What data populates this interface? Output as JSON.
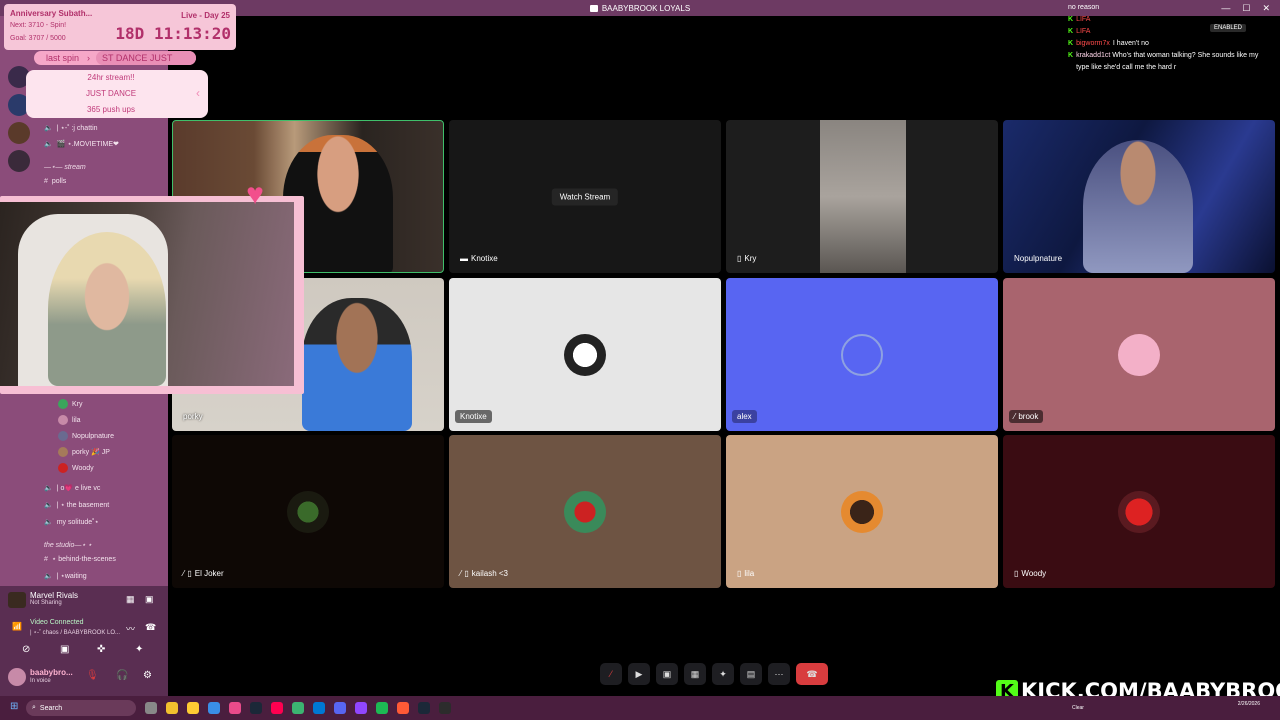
{
  "window": {
    "title": "BAABYBROOK LOYALS",
    "controls": [
      "—",
      "☐",
      "✕"
    ]
  },
  "overlay": {
    "title": "Anniversary Subath...",
    "next": "Next: 3710 - Spin!",
    "goal": "Goal: 3707 / 5000",
    "live": "Live - Day 25",
    "timer": "18D 11:13:20",
    "last_spin_label": "last spin",
    "last_spin_value": "ST DANCE JUST",
    "menu": [
      "24hr stream!!",
      "JUST DANCE",
      "365 push ups"
    ]
  },
  "sidebar": {
    "channels_top": [
      {
        "name": "| ⋆-˚ :j chattin",
        "icon": "speaker-icon"
      },
      {
        "name": "🎬 ⋆.MOVIETIME❤",
        "icon": "speaker-icon"
      }
    ],
    "category_stream": "—⋆— stream",
    "polls": "polls",
    "voice_users": [
      "Kry",
      "lila",
      "Nopulpnature",
      "porky 🎉 JP",
      "Woody"
    ],
    "channels_mid": [
      "| o💗 e live vc",
      "| ⋆ the basement",
      "my solitude˚⋆"
    ],
    "category_studio": "the studio—⋆ ⋆",
    "channels_bottom": [
      "⋆ behind-the-scenes",
      "| ⋆waiting"
    ]
  },
  "activity": {
    "game": "Marvel Rivals",
    "status": "Not Sharing"
  },
  "connection": {
    "status": "Video Connected",
    "channel": "| ⋆-˚ chaos / BAABYBROOK LO..."
  },
  "user": {
    "name": "baabybro...",
    "status": "In voice"
  },
  "tiles": [
    {
      "name": "",
      "type": "cam"
    },
    {
      "name": "Knotixe",
      "type": "stream",
      "watch": "Watch Stream"
    },
    {
      "name": "Kry",
      "type": "cam"
    },
    {
      "name": "Nopulpnature",
      "type": "cam"
    },
    {
      "name": "porky",
      "type": "cam"
    },
    {
      "name": "Knotixe",
      "type": "avatar"
    },
    {
      "name": "alex",
      "type": "avatar"
    },
    {
      "name": "brook",
      "type": "avatar"
    },
    {
      "name": "El Joker",
      "type": "avatar"
    },
    {
      "name": "kailash <3",
      "type": "avatar"
    },
    {
      "name": "lila",
      "type": "avatar"
    },
    {
      "name": "Woody",
      "type": "avatar"
    }
  ],
  "chat": {
    "header": "no reason",
    "enabled": "ENABLED",
    "lines": [
      {
        "user": "LIFA",
        "msg": ""
      },
      {
        "user": "LIFA",
        "msg": ""
      },
      {
        "user": "bigworm7x",
        "msg": "I haven't no"
      },
      {
        "user": "krakadd1ct",
        "msg": "Who's that woman talking? She sounds like my type like she'd call me the hard r"
      }
    ]
  },
  "kick": {
    "k": "K",
    "text": "KICK.COM/BAABYBROOK"
  },
  "taskbar": {
    "search": "Search",
    "weather": "Clear",
    "time": "2/26/2026"
  },
  "colors": {
    "discord_blurple": "#5865f2",
    "kick_green": "#53fc18",
    "hangup": "#d83c3e"
  }
}
